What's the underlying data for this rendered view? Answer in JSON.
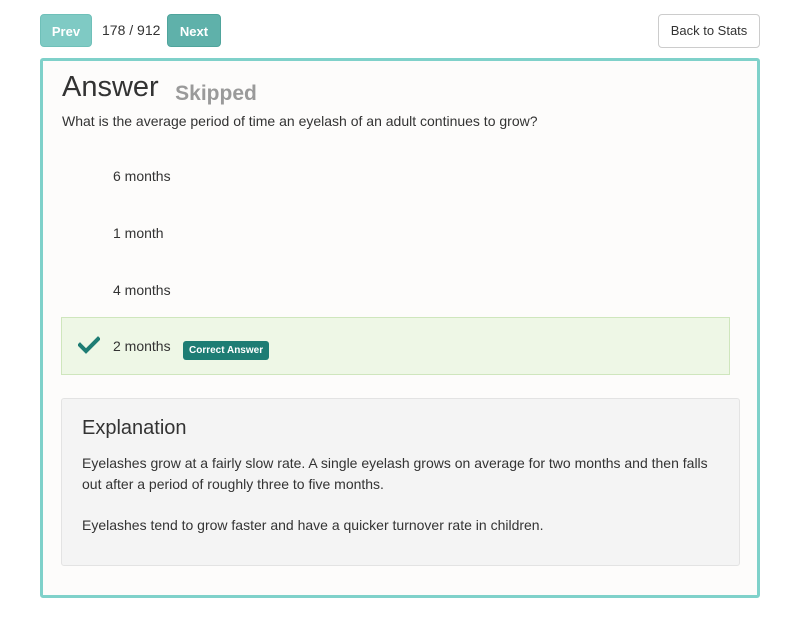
{
  "nav": {
    "prev_label": "Prev",
    "next_label": "Next",
    "counter": "178 / 912",
    "back_label": "Back to Stats"
  },
  "answer": {
    "title": "Answer",
    "status": "Skipped",
    "question": "What is the average period of time an eyelash of an adult continues to grow?"
  },
  "options": [
    {
      "label": "6 months",
      "correct": false
    },
    {
      "label": "1 month",
      "correct": false
    },
    {
      "label": "4 months",
      "correct": false
    },
    {
      "label": "2 months",
      "correct": true,
      "badge": "Correct Answer"
    }
  ],
  "explanation": {
    "title": "Explanation",
    "paragraphs": [
      "Eyelashes grow at a fairly slow rate. A single eyelash grows on average for two months and then falls out after a period of roughly three to five months.",
      "Eyelashes tend to grow faster and have a quicker turnover rate in children."
    ]
  },
  "colors": {
    "accent": "#7fd1ca",
    "nav_button": "#5fb1aa",
    "correct_bg": "#eef7e6",
    "badge": "#1e7d74",
    "check": "#1e7d74",
    "status_text": "#9a9a9a"
  },
  "icons": {
    "correct": "checkmark-icon"
  }
}
